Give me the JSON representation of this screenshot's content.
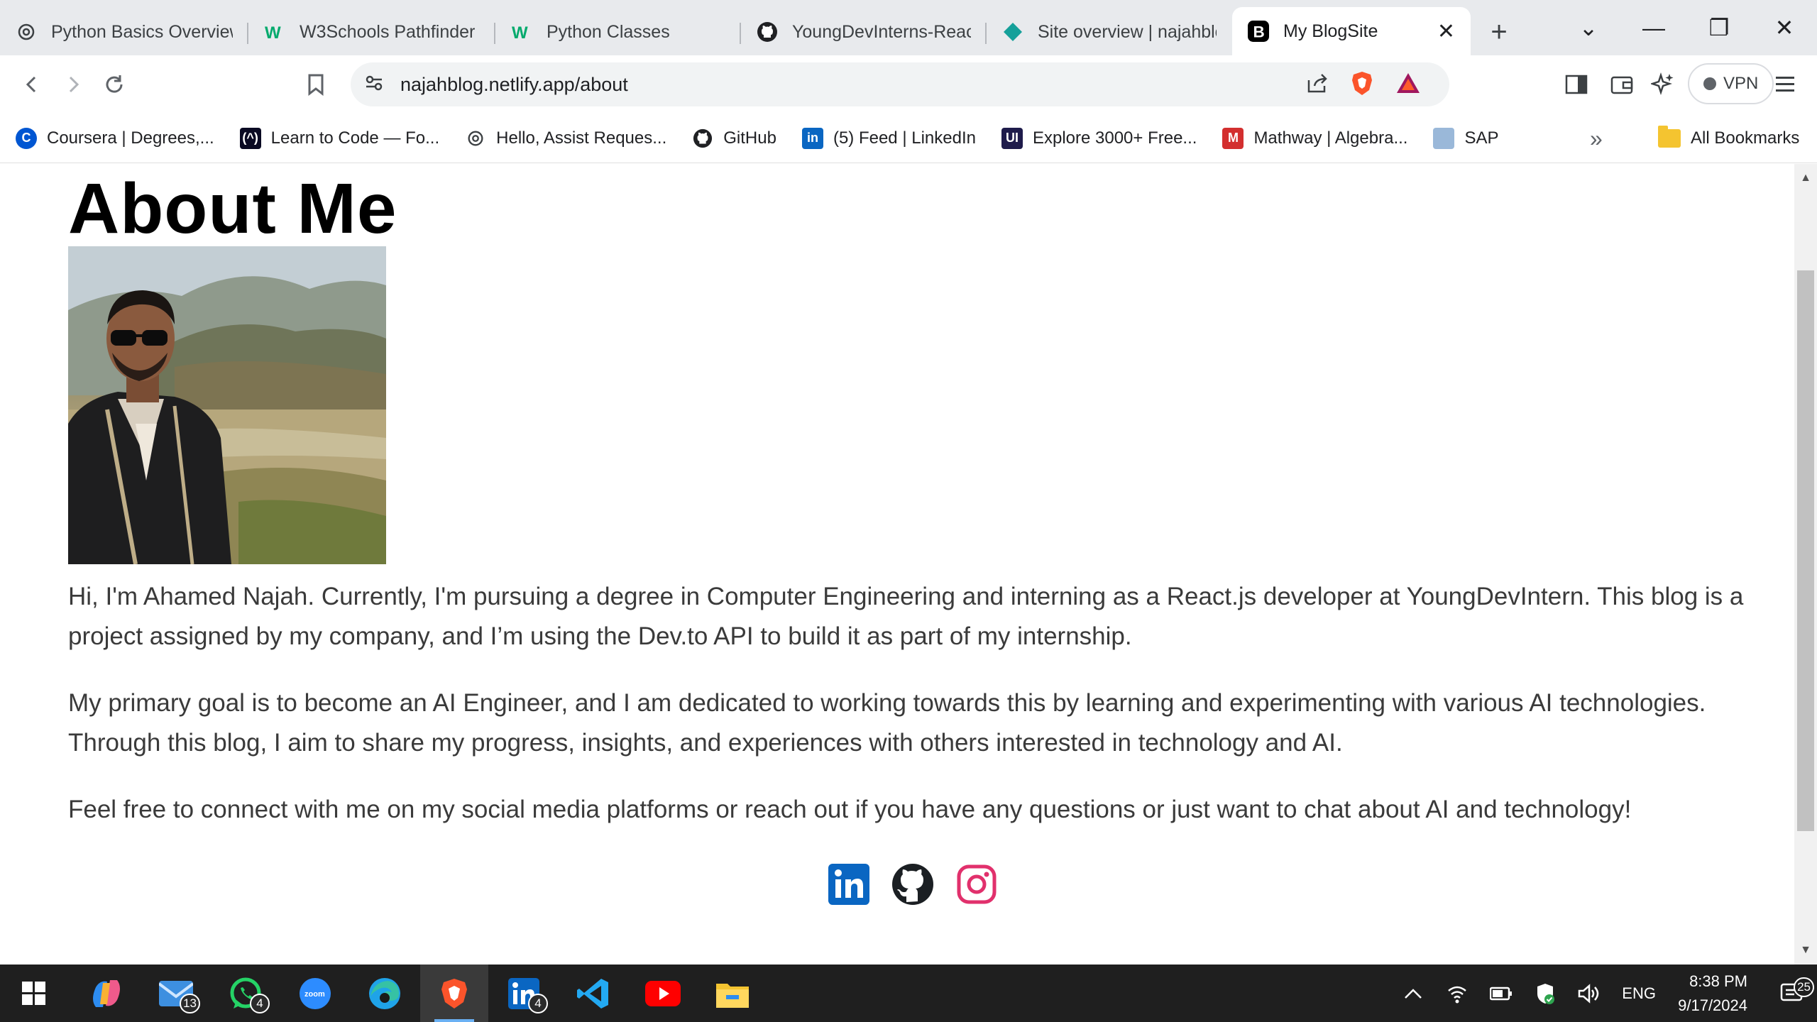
{
  "browser": {
    "tabs": [
      {
        "label": "Python Basics Overview",
        "icon": "openai-icon"
      },
      {
        "label": "W3Schools Pathfinder",
        "icon": "w3schools-icon"
      },
      {
        "label": "Python Classes",
        "icon": "w3schools-icon"
      },
      {
        "label": "YoungDevInterns-React",
        "icon": "github-icon"
      },
      {
        "label": "Site overview | najahblog",
        "icon": "netlify-icon"
      },
      {
        "label": "My BlogSite",
        "icon": "blog-icon",
        "active": true
      }
    ],
    "new_tab": "+",
    "address": "najahblog.netlify.app/about",
    "vpn_label": "VPN",
    "bookmarks": [
      {
        "label": "Coursera | Degrees,...",
        "icon": "coursera-icon",
        "color": "#0056d2"
      },
      {
        "label": "Learn to Code — Fo...",
        "icon": "freecodecamp-icon",
        "color": "#0a0a23"
      },
      {
        "label": "Hello, Assist Reques...",
        "icon": "openai-icon",
        "color": "#5f6368"
      },
      {
        "label": "GitHub",
        "icon": "github-icon",
        "color": "#000000"
      },
      {
        "label": "(5) Feed | LinkedIn",
        "icon": "linkedin-icon",
        "color": "#0a66c2"
      },
      {
        "label": "Explore 3000+ Free...",
        "icon": "uiverse-icon",
        "color": "#1e1b4b"
      },
      {
        "label": "Mathway | Algebra...",
        "icon": "mathway-icon",
        "color": "#d32f2f"
      },
      {
        "label": "SAP",
        "icon": "sap-icon",
        "color": "#9ab8d9"
      }
    ],
    "all_bookmarks": "All Bookmarks"
  },
  "page": {
    "heading": "About Me",
    "paragraphs": [
      "Hi, I'm Ahamed Najah. Currently, I'm pursuing a degree in Computer Engineering and interning as a React.js developer at YoungDevIntern. This blog is a project assigned by my company, and I’m using the Dev.to API to build it as part of my internship.",
      "My primary goal is to become an AI Engineer, and I am dedicated to working towards this by learning and experimenting with various AI technologies. Through this blog, I aim to share my progress, insights, and experiences with others interested in technology and AI.",
      "Feel free to connect with me on my social media platforms or reach out if you have any questions or just want to chat about AI and technology!"
    ],
    "socials": [
      "linkedin-icon",
      "github-icon",
      "instagram-icon"
    ],
    "colors": {
      "linkedin": "#0a66c2",
      "github": "#1b1f23",
      "instagram": "#e1306c"
    }
  },
  "taskbar": {
    "apps": [
      {
        "name": "start-icon"
      },
      {
        "name": "copilot-icon"
      },
      {
        "name": "mail-icon",
        "badge": "13"
      },
      {
        "name": "whatsapp-icon",
        "badge": "4"
      },
      {
        "name": "zoom-icon",
        "text": "zoom"
      },
      {
        "name": "edge-icon"
      },
      {
        "name": "brave-icon",
        "active": true
      },
      {
        "name": "linkedin-app-icon",
        "badge": "4"
      },
      {
        "name": "vscode-icon"
      },
      {
        "name": "youtube-icon"
      },
      {
        "name": "file-explorer-icon"
      }
    ],
    "language": "ENG",
    "time": "8:38 PM",
    "date": "9/17/2024",
    "notifications": "25"
  }
}
